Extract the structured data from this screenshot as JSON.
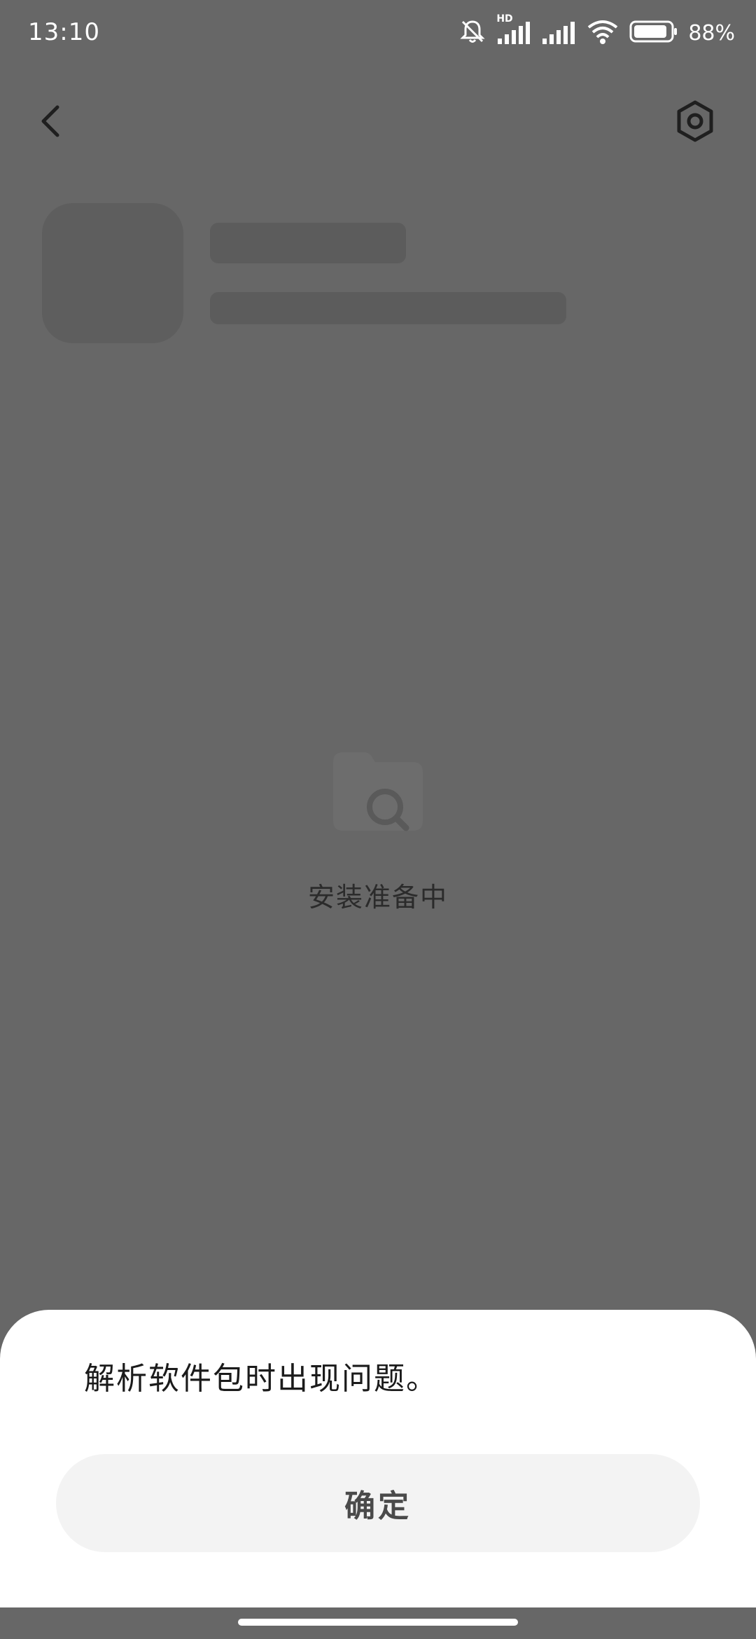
{
  "status_bar": {
    "time": "13:10",
    "network_badge": "HD",
    "battery": "88%",
    "icons": [
      "bell-off-icon",
      "signal-icon",
      "signal-icon",
      "wifi-icon",
      "battery-icon"
    ]
  },
  "topbar": {
    "back_icon": "chevron-left-icon",
    "settings_icon": "hexagon-settings-icon"
  },
  "main": {
    "status_text": "安装准备中",
    "illustration_icon": "folder-search-icon"
  },
  "dialog": {
    "message": "解析软件包时出现问题。",
    "confirm_label": "确定"
  },
  "colors": {
    "overlay": "#676767",
    "sheet": "#ffffff",
    "button_bg": "#f3f3f3"
  }
}
